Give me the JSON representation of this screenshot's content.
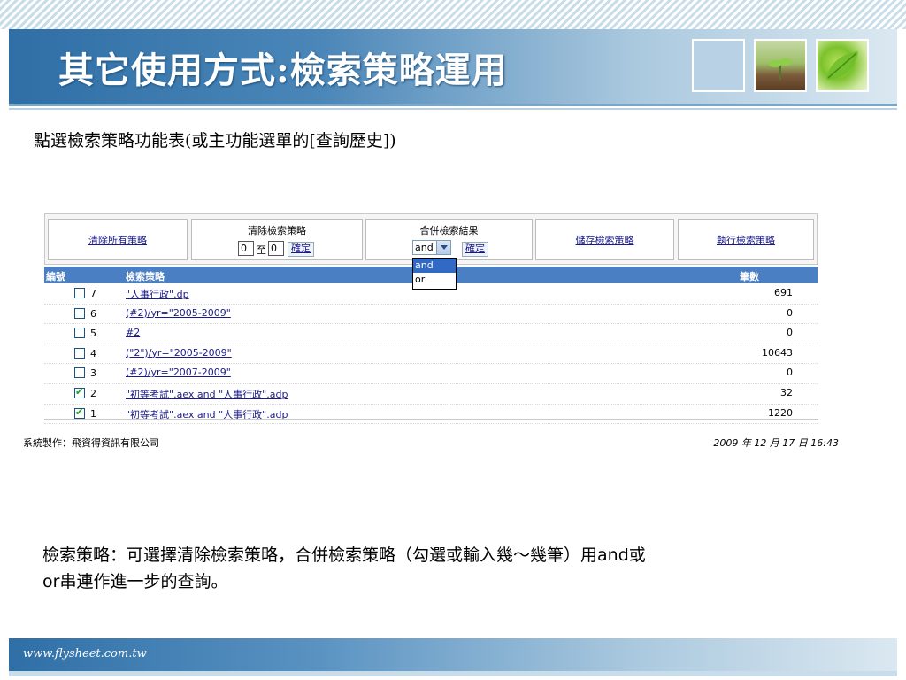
{
  "slide": {
    "title": "其它使用方式:檢索策略運用",
    "subtitle": "點選檢索策略功能表(或主功能選單的[查詢歷史])",
    "description_line1_a": "檢索策略：可選擇清除檢索策略，合併檢索策略（勾選或輸入幾～幾筆）用",
    "description_line1_and": "and",
    "description_line1_b": "或",
    "description_line2_or": "or",
    "description_line2_b": "串連作進一步的查詢。",
    "footer_url": "www.flysheet.com.tw"
  },
  "toolbar": {
    "clear_all": "清除所有策略",
    "clear_caption": "清除檢索策略",
    "clear_from": "0",
    "clear_to_label": "至",
    "clear_to": "0",
    "confirm": "確定",
    "merge_caption": "合併檢索結果",
    "merge_selected": "and",
    "merge_options": [
      "and",
      "or"
    ],
    "save": "儲存檢索策略",
    "execute": "執行檢索策略"
  },
  "table": {
    "headers": {
      "no": "編號",
      "strategy": "檢索策略",
      "count": "筆數"
    },
    "rows": [
      {
        "checked": false,
        "no": "7",
        "strategy": "\"人事行政\".dp",
        "count": "691"
      },
      {
        "checked": false,
        "no": "6",
        "strategy": "(#2)/yr=\"2005-2009\"",
        "count": "0"
      },
      {
        "checked": false,
        "no": "5",
        "strategy": "#2",
        "count": "0"
      },
      {
        "checked": false,
        "no": "4",
        "strategy": "(\"2\")/yr=\"2005-2009\"",
        "count": "10643"
      },
      {
        "checked": false,
        "no": "3",
        "strategy": "(#2)/yr=\"2007-2009\"",
        "count": "0"
      },
      {
        "checked": true,
        "no": "2",
        "strategy": "\"初等考試\".aex and \"人事行政\".adp",
        "count": "32"
      },
      {
        "checked": true,
        "no": "1",
        "strategy": "\"初等考試\".aex and \"人事行政\".adp",
        "count": "1220"
      }
    ]
  },
  "footer": {
    "system": "系統製作：飛資得資訊有限公司",
    "datetime": "2009 年 12 月 17 日 16:43"
  }
}
